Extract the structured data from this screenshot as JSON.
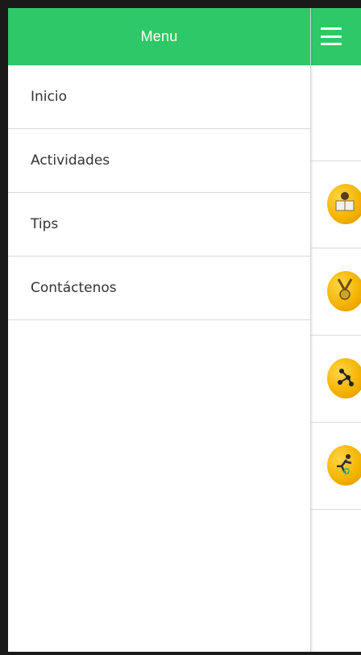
{
  "drawer": {
    "title": "Menu",
    "items": [
      {
        "label": "Inicio"
      },
      {
        "label": "Actividades"
      },
      {
        "label": "Tips"
      },
      {
        "label": "Contáctenos"
      }
    ]
  },
  "page": {
    "header_color": "#2ec866",
    "menu_icon": "hamburger-icon",
    "list_icons": [
      "reading-person-icon",
      "medal-icon",
      "molecule-icon",
      "runner-icon"
    ]
  }
}
